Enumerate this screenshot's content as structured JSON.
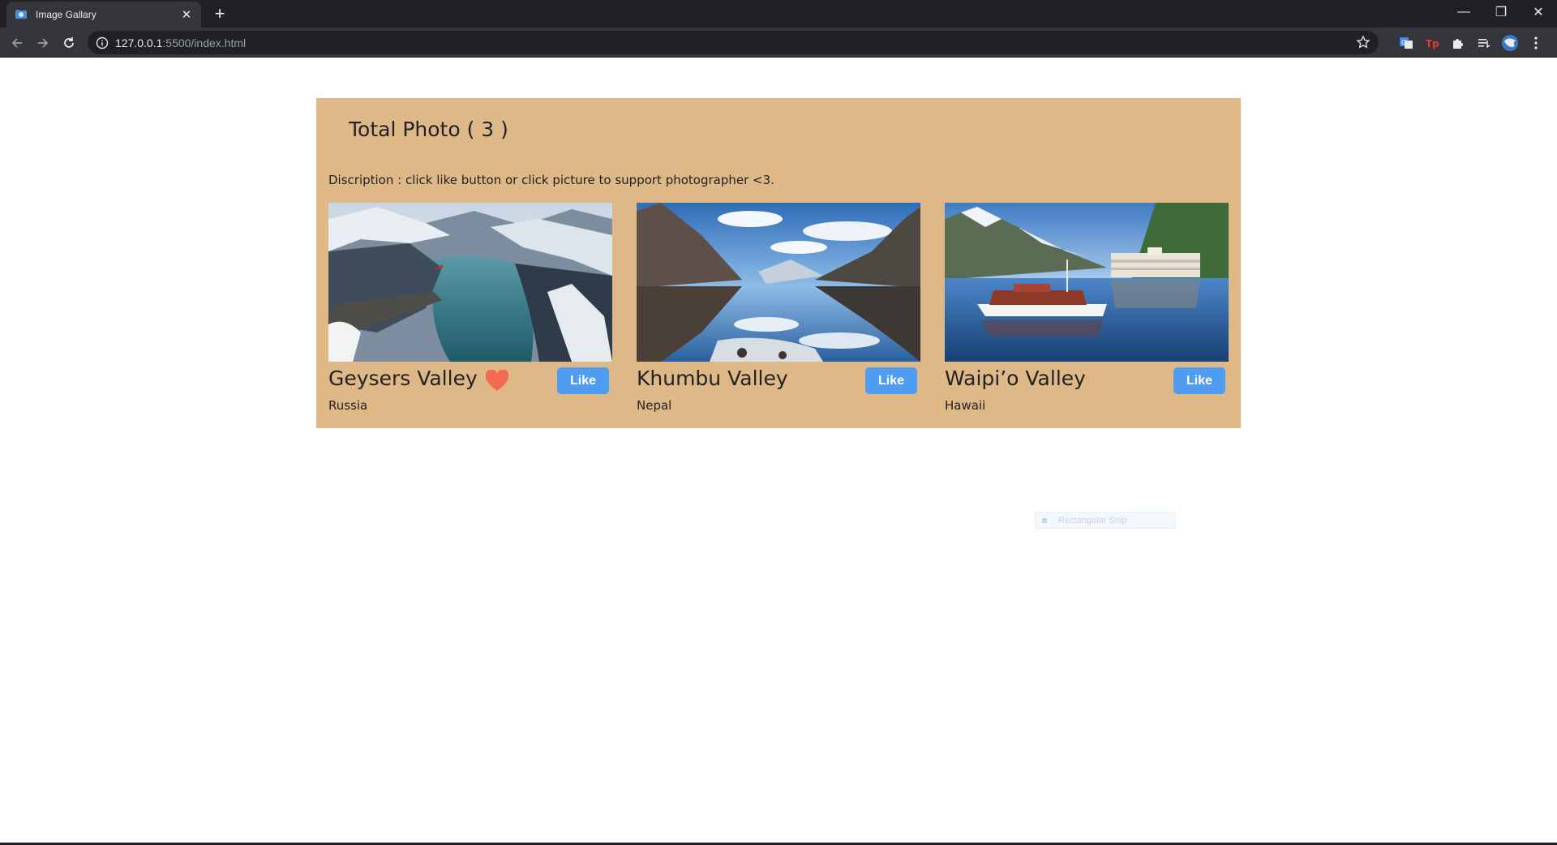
{
  "browser": {
    "tab_title": "Image Gallary",
    "tab_close": "✕",
    "new_tab": "+",
    "url_host": "127.0.0.1",
    "url_path": ":5500/index.html",
    "window": {
      "minimize": "—",
      "restore": "❐",
      "close": "✕"
    }
  },
  "page": {
    "title": "Total Photo ( 3 )",
    "description": "Discription : click like button or click picture to support photographer <3.",
    "accent_color": "#deb887",
    "button_color": "#4e9df3",
    "heart_color": "#f26a4f",
    "photos": [
      {
        "title": "Geysers Valley",
        "location": "Russia",
        "like_label": "Like",
        "liked": true
      },
      {
        "title": "Khumbu Valley",
        "location": "Nepal",
        "like_label": "Like",
        "liked": false
      },
      {
        "title": "Waipi’o Valley",
        "location": "Hawaii",
        "like_label": "Like",
        "liked": false
      }
    ]
  },
  "overlay": {
    "snip_label": "Rectangular Snip"
  }
}
